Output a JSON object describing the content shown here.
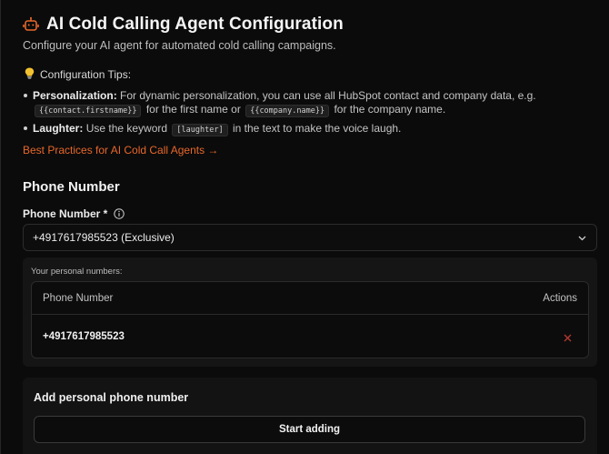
{
  "header": {
    "icon": "robot-icon",
    "title": "AI Cold Calling Agent Configuration",
    "subtitle": "Configure your AI agent for automated cold calling campaigns."
  },
  "tips": {
    "icon": "lightbulb-icon",
    "heading": "Configuration Tips:",
    "personalization": {
      "label": "Personalization:",
      "text_before": "For dynamic personalization, you can use all HubSpot contact and company data, e.g.",
      "code1": "{{contact.firstname}}",
      "text_mid": "for the first name or",
      "code2": "{{company.name}}",
      "text_after": "for the company name."
    },
    "laughter": {
      "label": "Laughter:",
      "text_before": "Use the keyword",
      "code": "[laughter]",
      "text_after": "in the text to make the voice laugh."
    },
    "link": "Best Practices for AI Cold Call Agents →"
  },
  "phone_section": {
    "title": "Phone Number",
    "field_label": "Phone Number *",
    "selected_value": "+4917617985523 (Exclusive)",
    "personal_label": "Your personal numbers:",
    "table": {
      "columns": [
        "Phone Number",
        "Actions"
      ],
      "rows": [
        {
          "number": "+4917617985523",
          "action_icon": "delete-x-icon"
        }
      ]
    }
  },
  "add_section": {
    "title": "Add personal phone number",
    "button": "Start adding"
  },
  "colors": {
    "accent": "#e8672a",
    "delete": "#b33a30",
    "background": "#0b0b0b"
  }
}
